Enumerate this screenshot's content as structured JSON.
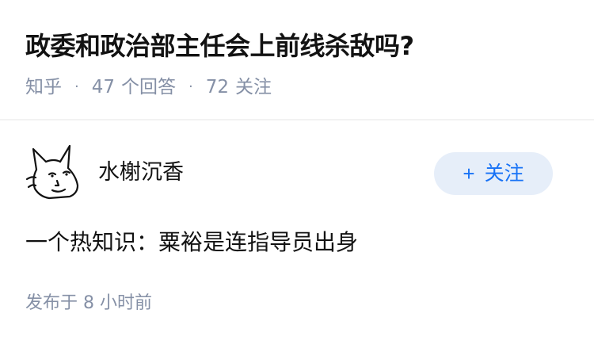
{
  "question": {
    "title": "政委和政治部主任会上前线杀敌吗?",
    "meta": {
      "site": "知乎",
      "answer_count": "47",
      "answer_label": "个回答",
      "follower_count": "72",
      "follower_label": "关注"
    }
  },
  "answer": {
    "author": {
      "name": "水榭沉香",
      "avatar_icon": "dog-face-sketch-icon"
    },
    "follow_button": {
      "plus": "+",
      "label": "关注"
    },
    "content": "一个热知识：粟裕是连指导员出身",
    "time": {
      "label": "发布于",
      "value": "8 小时前"
    }
  },
  "colors": {
    "title": "#121212",
    "meta": "#8590a6",
    "accent": "#1772f6",
    "button_bg": "#e6eef9",
    "divider": "#f2f2f2"
  }
}
